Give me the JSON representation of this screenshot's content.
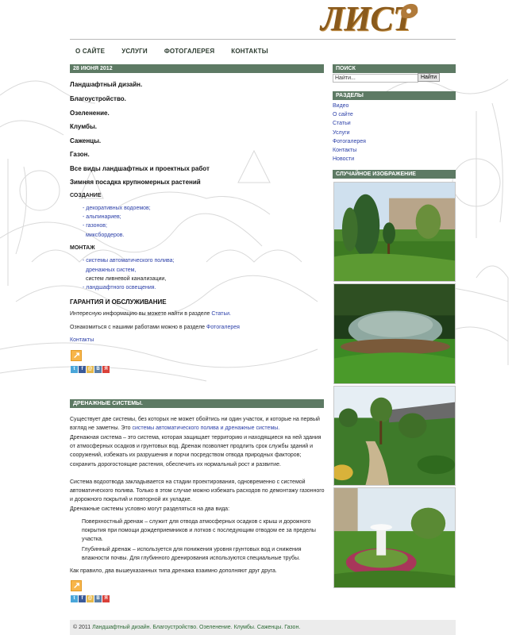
{
  "logo": {
    "text": "ЛИСТ"
  },
  "nav": [
    "О САЙТЕ",
    "УСЛУГИ",
    "ФОТОГАЛЕРЕЯ",
    "КОНТАКТЫ"
  ],
  "post1": {
    "date": "28 ИЮНЯ 2012",
    "headings": [
      "Ландшафтный дизайн.",
      "Благоустройство.",
      "Озеленение.",
      "Клумбы.",
      "Саженцы.",
      "Газон.",
      "Все виды ландшафтных и проектных работ",
      "Зимняя  посадка крупномерных растений"
    ],
    "create_title": "СОЗДАНИЕ",
    "create_items": [
      "- декоративных водоемов;",
      "- альпинариев;",
      "- газонов;",
      "миксбордеров."
    ],
    "mount_title": "МОНТАЖ",
    "mount_items": [
      "- системы автоматического полива;",
      "дренажных систем,",
      "систем ливневой канализации,",
      "- ландшафтного освещения."
    ],
    "guarantee_title": "ГАРАНТИЯ И ОБСЛУЖИВАНИЕ",
    "info_text": "Интересную информацию вы можете найти в разделе",
    "info_link": "Статьи.",
    "works_text": "Ознакомиться с нашими работами можно в разделе",
    "works_link": "Фотогалерея",
    "contacts_link": "Контакты"
  },
  "post2": {
    "title": "ДРЕНАЖНЫЕ СИСТЕМЫ.",
    "p1a": "Существует две системы, без которых не может обойтись ни один участок, и которые на первый взгляд не заметны. Это",
    "p1link": "системы автоматического полива и дренажные системы.",
    "p2": "Дренажная система – это система, которая защищает территорию и находящиеся на ней здания от атмосферных осадков и грунтовых вод. Дренаж позволяет продлить срок службы зданий и сооружений, избежать их разрушения и порчи посредством отвода природных факторов; сохранить дорогостоящие растения, обеспечить их нормальный рост и развитие.",
    "p3": "Система водоотвода закладывается на стадии проектирования, одновременно с системой автоматического полива. Только в этом случае можно избежать расходов по демонтажу газонного и дорожного покрытий и повторной их укладке.",
    "p4": "Дренажные системы условно могут разделяться на два вида:",
    "item1": "Поверхностный дренаж – служит для отвода атмосферных осадков с крыш и дорожного покрытия при помощи дождеприемников и лотков с последующим отводом ее за пределы участка.",
    "item2": "Глубинный дренаж – используется для понижения уровня грунтовых вод и снижения влажности почвы. Для глубинного дренирования используются специальные трубы.",
    "p5": "Как правило, два вышеуказанных типа дренажа взаимно дополняют друг друга."
  },
  "sidebar": {
    "search_title": "ПОИСК",
    "search_value": "Найти...",
    "search_button": "Найти",
    "sections_title": "РАЗДЕЛЫ",
    "sections": [
      "Видео",
      "О сайте",
      "Статьи",
      "Услуги",
      "Фотогалерея",
      "Контакты",
      "Новости"
    ],
    "random_title": "СЛУЧАЙНОЕ ИЗОБРАЖЕНИЕ"
  },
  "footer": {
    "copyright": "© 2011",
    "links": "Ландшафтный дизайн. Благоустройство. Озеленение. Клумбы. Саженцы. Газон."
  },
  "colors": {
    "bar": "#5d7a64",
    "link": "#2b3fa8",
    "logo": "#8a5a1c",
    "footer_link": "#2c6a35"
  },
  "icons": {
    "rss": "rss-icon",
    "social": [
      "twitter-icon",
      "facebook-icon",
      "moimir-icon",
      "vkontakte-icon",
      "yandex-icon"
    ]
  }
}
